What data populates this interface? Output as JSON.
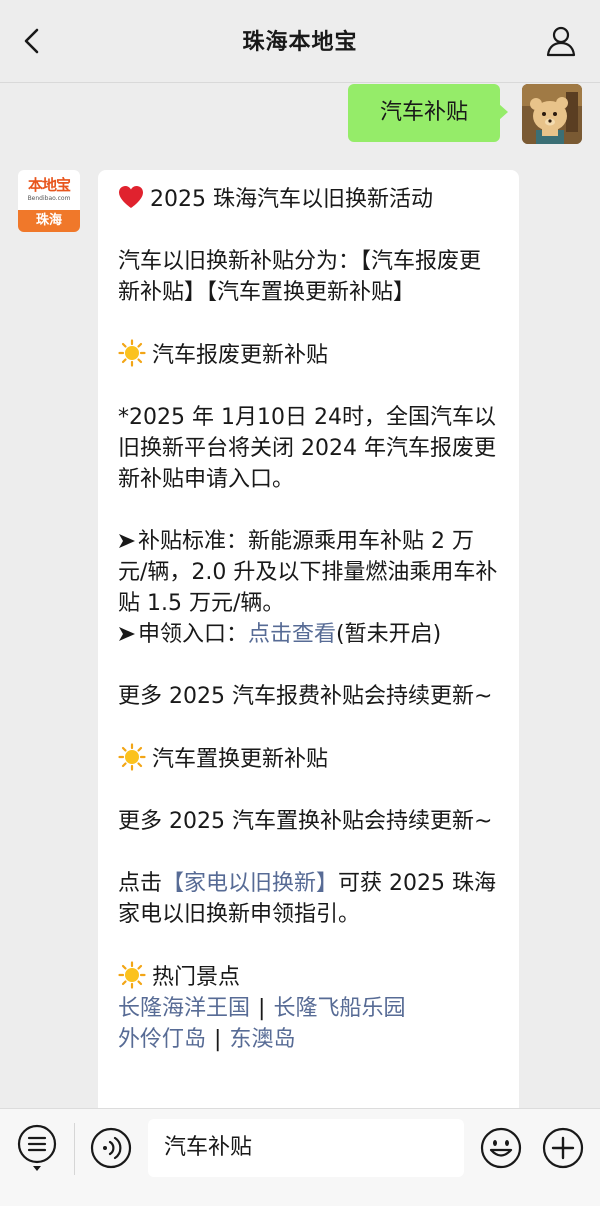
{
  "header": {
    "title": "珠海本地宝",
    "back_icon": "chevron-left-icon",
    "profile_icon": "person-icon"
  },
  "outgoing": {
    "text": "汽车补贴",
    "avatar": "bear-avatar"
  },
  "incoming": {
    "avatar": {
      "brand_cn": "本地宝",
      "brand_en": "Bendibao.com",
      "city": "珠海"
    },
    "headline": "2025 珠海汽车以旧换新活动",
    "intro": "汽车以旧换新补贴分为：【汽车报废更新补贴】【汽车置换更新补贴】",
    "section1_title": "汽车报废更新补贴",
    "section1_notice": "*2025 年 1月10日 24时，全国汽车以旧换新平台将关闭 2024 年汽车报废更新补贴申请入口。",
    "standard_text": "补贴标准：新能源乘用车补贴 2 万元/辆，2.0 升及以下排量燃油乘用车补贴 1.5 万元/辆。",
    "apply_label": "申领入口：",
    "apply_link": "点击查看",
    "apply_note": "(暂未开启)",
    "section1_more": "更多 2025 汽车报费补贴会持续更新~",
    "section2_title": "汽车置换更新补贴",
    "section2_more": "更多 2025 汽车置换补贴会持续更新~",
    "click_prefix": "点击",
    "click_link": "【家电以旧换新】",
    "click_suffix": "可获 2025 珠海家电以旧换新申领指引。",
    "section3_title": "热门景点",
    "spots": [
      "长隆海洋王国",
      "长隆飞船乐园",
      "外伶仃岛",
      "东澳岛"
    ],
    "spot_separator": "|"
  },
  "input_bar": {
    "menu_icon": "menu-list-icon",
    "voice_icon": "voice-icon",
    "text": "汽车补贴",
    "emoji_icon": "emoji-icon",
    "plus_icon": "plus-icon"
  },
  "colors": {
    "bubble_green": "#95ec69",
    "link": "#576b95",
    "background": "#ededed",
    "brand_orange": "#f0782a"
  }
}
